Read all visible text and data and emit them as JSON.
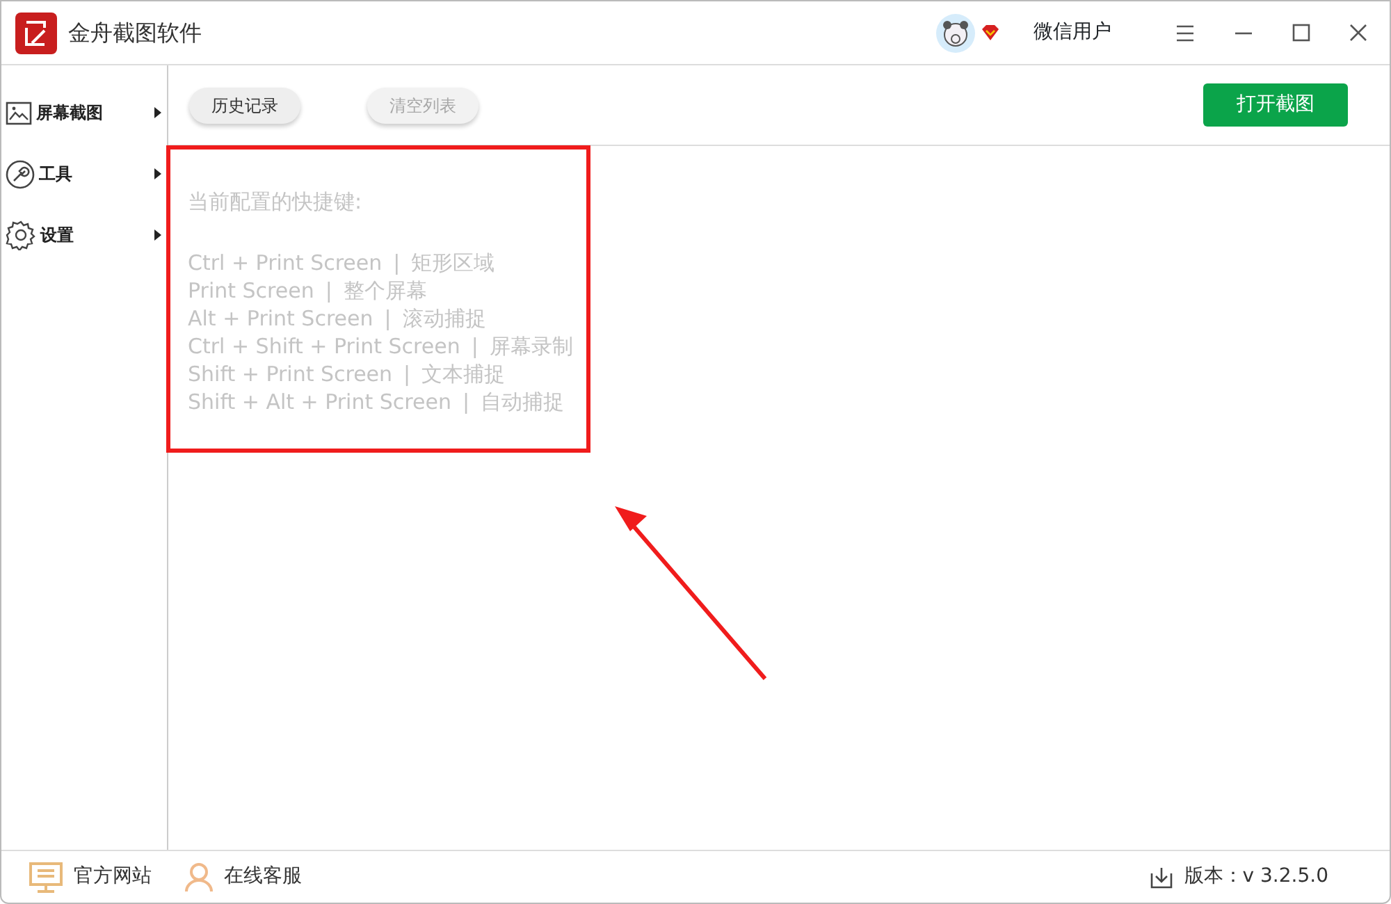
{
  "window": {
    "title": "金舟截图软件",
    "user_name": "微信用户"
  },
  "toolbar": {
    "buttons": [
      {
        "label": "历史记录",
        "disabled": false
      },
      {
        "label": "清空列表",
        "disabled": true
      }
    ],
    "primary_button": "打开截图"
  },
  "sidebar": {
    "items": [
      {
        "label": "屏幕截图"
      },
      {
        "label": "工具"
      },
      {
        "label": "设置"
      }
    ]
  },
  "content": {
    "heading": "当前配置的快捷键:",
    "shortcuts": [
      {
        "keys": "Ctrl + Print Screen",
        "separator": "|",
        "action": "矩形区域"
      },
      {
        "keys": "Print Screen",
        "separator": "|",
        "action": "整个屏幕"
      },
      {
        "keys": "Alt + Print Screen",
        "separator": "|",
        "action": "滚动捕捉"
      },
      {
        "keys": "Ctrl + Shift + Print Screen",
        "separator": "|",
        "action": "屏幕录制"
      },
      {
        "keys": "Shift + Print Screen",
        "separator": "|",
        "action": "文本捕捉"
      },
      {
        "keys": "Shift + Alt + Print Screen",
        "separator": "|",
        "action": "自动捕捉"
      }
    ]
  },
  "status_bar": {
    "links": [
      {
        "label": "官方网站"
      },
      {
        "label": "在线客服"
      }
    ],
    "version": "版本：v 3.2.5.0"
  }
}
